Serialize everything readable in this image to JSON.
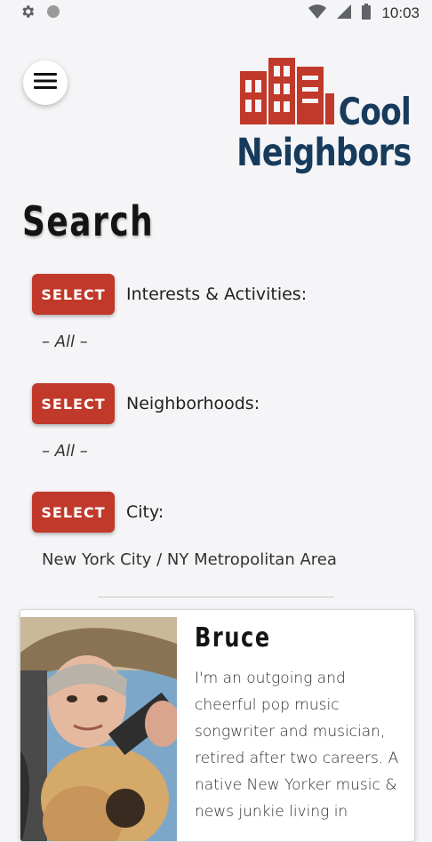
{
  "status_bar": {
    "time": "10:03",
    "icons": [
      "gear-icon",
      "circle-icon",
      "wifi-icon",
      "cell-signal-icon",
      "battery-icon"
    ]
  },
  "header": {
    "menu_icon": "hamburger-icon",
    "logo_line1": "Cool",
    "logo_line2": "Neighbors",
    "brand_color": "#c0392b",
    "logo_text_color": "#173b5c"
  },
  "page": {
    "title": "Search"
  },
  "filters": [
    {
      "button_label": "SELECT",
      "label": "Interests & Activities:",
      "value": "– All –"
    },
    {
      "button_label": "SELECT",
      "label": "Neighborhoods:",
      "value": "– All –"
    },
    {
      "button_label": "SELECT",
      "label": "City:",
      "value": "New York City / NY Metropolitan Area"
    }
  ],
  "results": [
    {
      "name": "Bruce",
      "bio": "I'm an outgoing and cheerful pop music songwriter and musician, retired after two careers. A native New Yorker music & news junkie living in"
    }
  ]
}
